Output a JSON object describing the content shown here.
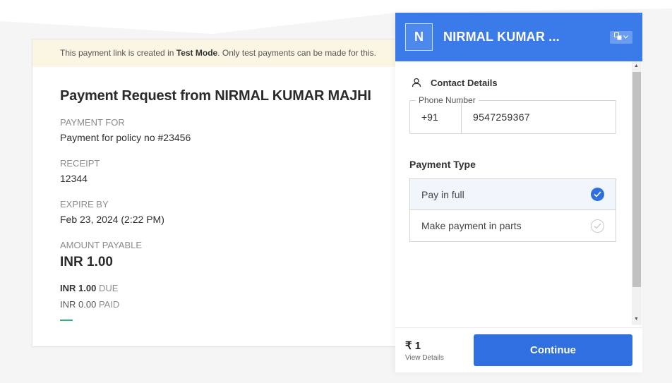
{
  "banner": {
    "prefix": "This payment link is created in ",
    "mode": "Test Mode",
    "suffix": ". Only test payments can be made for this."
  },
  "request": {
    "title": "Payment Request from NIRMAL KUMAR MAJHI",
    "payment_for_label": "PAYMENT FOR",
    "payment_for_value": "Payment for policy no #23456",
    "receipt_label": "RECEIPT",
    "receipt_value": "12344",
    "expire_label": "EXPIRE BY",
    "expire_value": "Feb 23, 2024 (2:22 PM)",
    "amount_label": "AMOUNT PAYABLE",
    "amount_value": "INR 1.00",
    "due_amount": "INR 1.00",
    "due_label": "DUE",
    "paid_amount": "INR 0.00",
    "paid_label": "PAID",
    "paid_progress_pct": 0
  },
  "checkout": {
    "logo_letter": "N",
    "merchant_name": "NIRMAL KUMAR ...",
    "contact_title": "Contact Details",
    "phone_label": "Phone Number",
    "country_code": "+91",
    "phone_number": "9547259367",
    "payment_type_title": "Payment Type",
    "options": [
      {
        "label": "Pay in full",
        "selected": true
      },
      {
        "label": "Make payment in parts",
        "selected": false
      }
    ],
    "price": "₹ 1",
    "view_details": "View Details",
    "continue_label": "Continue"
  },
  "colors": {
    "primary": "#3b7be9",
    "button": "#2f6fe0",
    "banner_bg": "#fbf6e4",
    "progress": "#2bb673"
  }
}
